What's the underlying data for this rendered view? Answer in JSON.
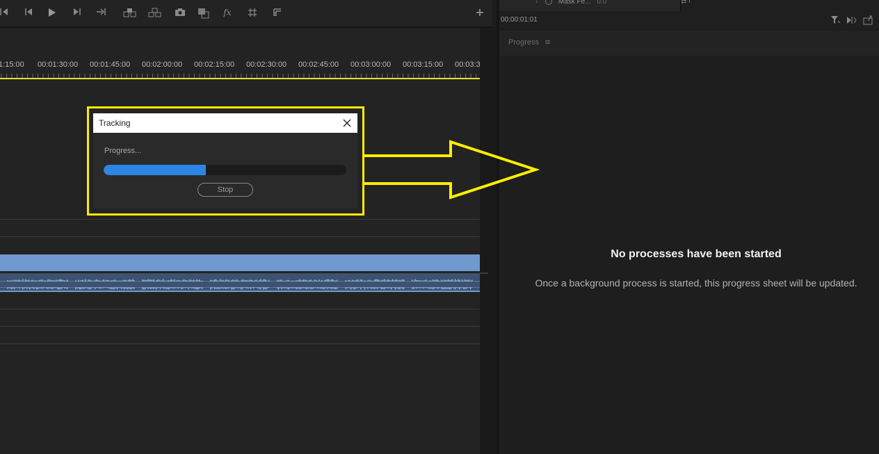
{
  "timeline": {
    "timecodes": [
      "1:15:00",
      "00:01:30:00",
      "00:01:45:00",
      "00:02:00:00",
      "00:02:15:00",
      "00:02:30:00",
      "00:02:45:00",
      "00:03:00:00",
      "00:03:15:00",
      "00:03:3"
    ]
  },
  "source_panel": {
    "mask_label": "Mask Fe...",
    "mask_value": "0.0",
    "timecode": "00:00:01:01"
  },
  "progress_panel": {
    "tab_label": "Progress",
    "menu_icon": "≡",
    "empty_title": "No processes have been started",
    "empty_description": "Once a background process is started, this progress sheet will be updated."
  },
  "dialog": {
    "title": "Tracking",
    "progress_label": "Progress...",
    "progress_fraction": 0.42,
    "stop_label": "Stop"
  },
  "colors": {
    "highlight": "#ffee00",
    "progress_fill": "#2d86e3",
    "video_clip": "#7099cf",
    "playhead": "#e8e238"
  },
  "transport_icons": [
    "go-to-in-icon",
    "step-back-icon",
    "play-icon",
    "step-forward-icon",
    "go-to-out-icon",
    "lift-icon",
    "extract-icon",
    "export-frame-icon",
    "comparison-view-icon",
    "fx-icon",
    "safe-margins-icon",
    "settings-icon",
    "add-button-icon"
  ]
}
